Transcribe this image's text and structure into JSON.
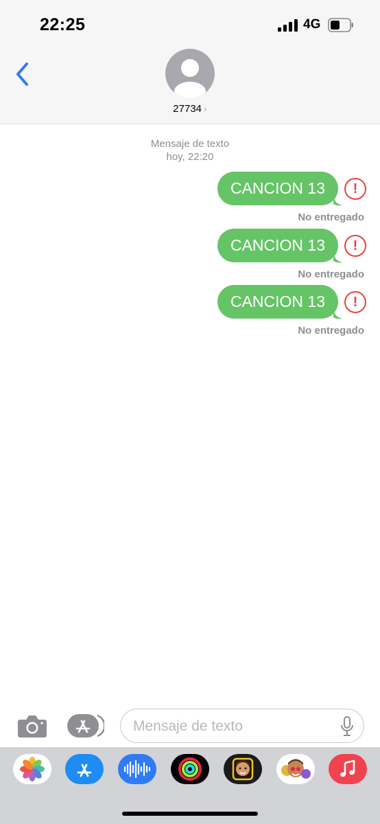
{
  "status_bar": {
    "time": "22:25",
    "network": "4G"
  },
  "header": {
    "contact": "27734",
    "chevron": "›"
  },
  "conversation": {
    "meta_label": "Mensaje de texto",
    "meta_time": "hoy, 22:20",
    "messages": [
      {
        "text": "CANCION 13",
        "status": "No entregado",
        "error_glyph": "!"
      },
      {
        "text": "CANCION 13",
        "status": "No entregado",
        "error_glyph": "!"
      },
      {
        "text": "CANCION 13",
        "status": "No entregado",
        "error_glyph": "!"
      }
    ]
  },
  "compose": {
    "placeholder": "Mensaje de texto"
  },
  "app_drawer": {
    "apps": [
      "photos-icon",
      "app-store-icon",
      "audio-message-icon",
      "activity-icon",
      "memoji-icon",
      "memoji-stickers-icon",
      "music-icon"
    ]
  },
  "colors": {
    "bubble": "#65c466",
    "error": "#e5433f",
    "accent": "#2f7bf5"
  }
}
